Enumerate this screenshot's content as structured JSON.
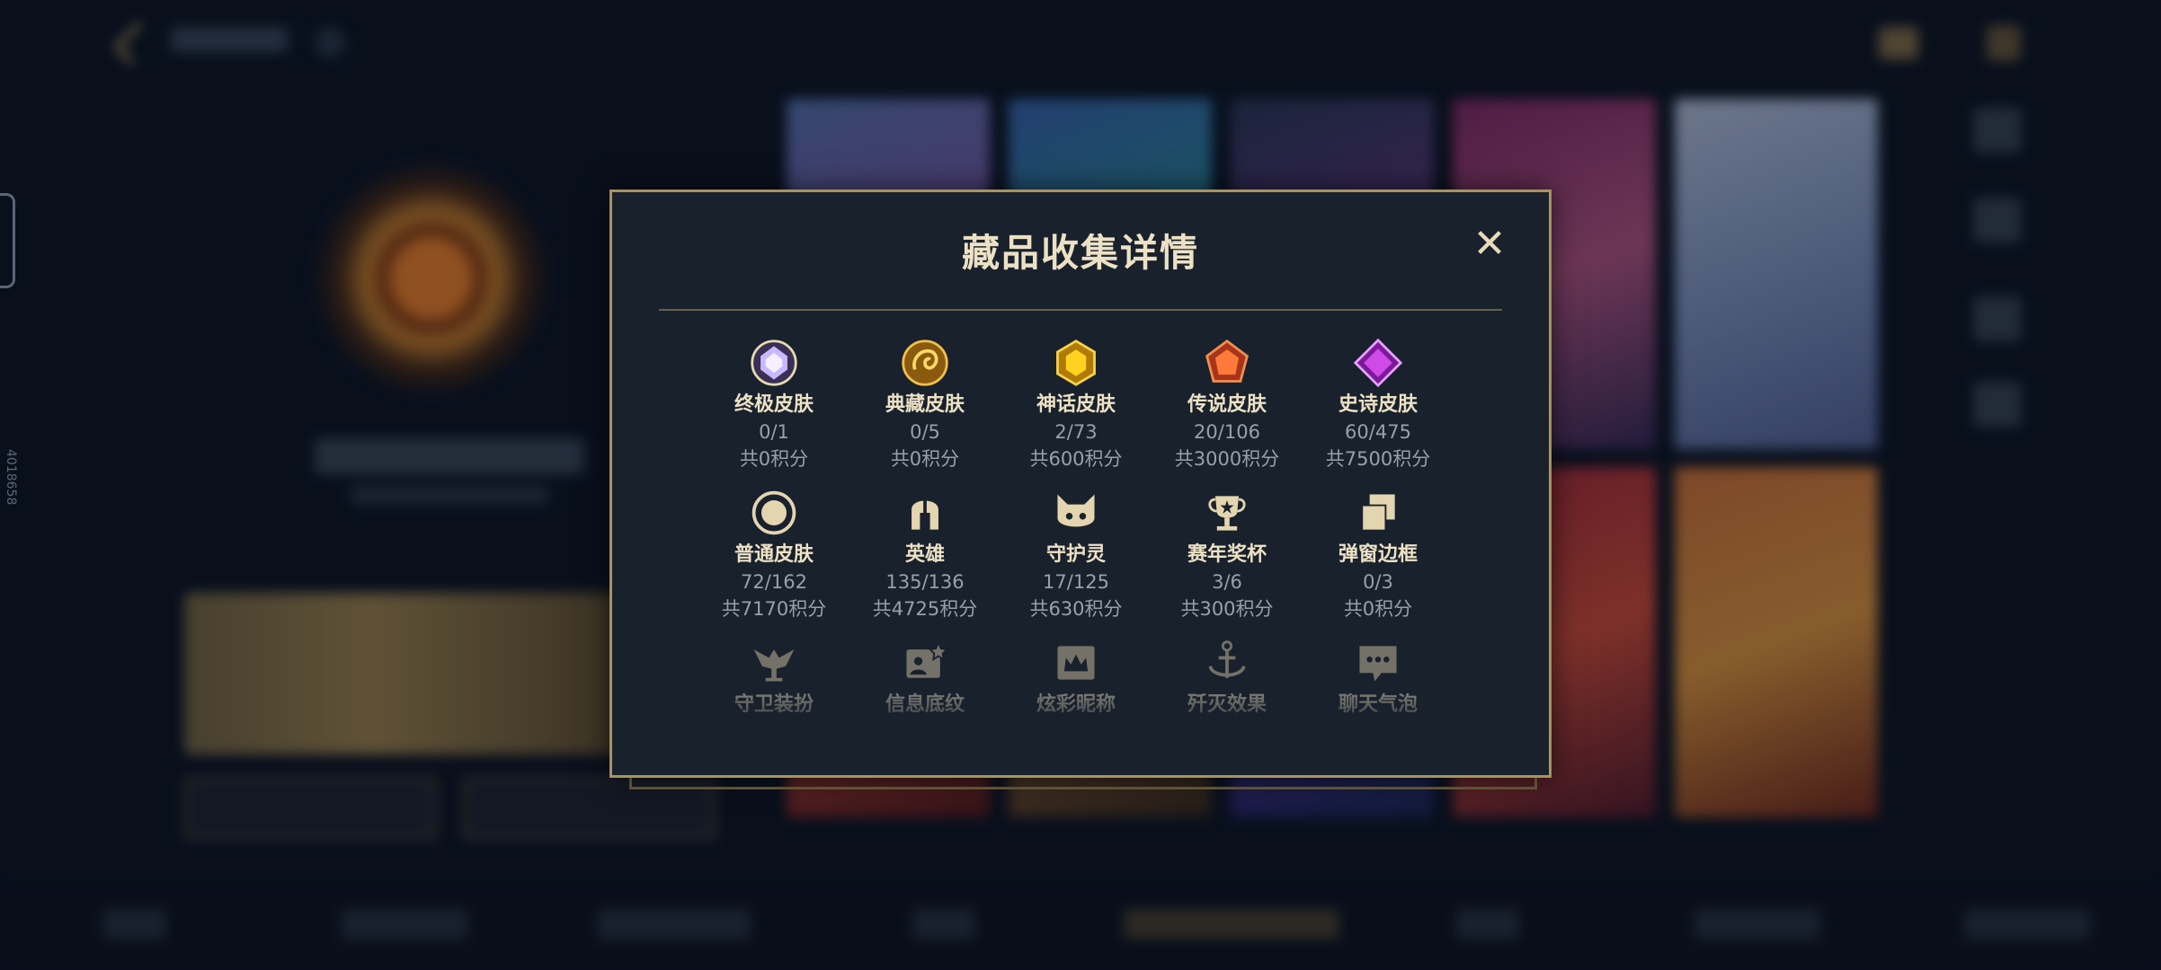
{
  "dialog": {
    "title": "藏品收集详情",
    "close_label": "✕"
  },
  "side_id": "4018658",
  "categories": [
    {
      "name": "终极皮肤",
      "count": "0/1",
      "points": "共0积分",
      "icon": "ultimate-skin-icon",
      "color": "#b9a6f0"
    },
    {
      "name": "典藏皮肤",
      "count": "0/5",
      "points": "共0积分",
      "icon": "collector-skin-icon",
      "color": "#e8b640"
    },
    {
      "name": "神话皮肤",
      "count": "2/73",
      "points": "共600积分",
      "icon": "mythic-skin-icon",
      "color": "#f0c21f"
    },
    {
      "name": "传说皮肤",
      "count": "20/106",
      "points": "共3000积分",
      "icon": "legendary-skin-icon",
      "color": "#f06a2a"
    },
    {
      "name": "史诗皮肤",
      "count": "60/475",
      "points": "共7500积分",
      "icon": "epic-skin-icon",
      "color": "#c63cd8"
    },
    {
      "name": "普通皮肤",
      "count": "72/162",
      "points": "共7170积分",
      "icon": "standard-skin-icon",
      "color": "#e3d5b0"
    },
    {
      "name": "英雄",
      "count": "135/136",
      "points": "共4725积分",
      "icon": "hero-helmet-icon",
      "color": "#e3d5b0"
    },
    {
      "name": "守护灵",
      "count": "17/125",
      "points": "共630积分",
      "icon": "guardian-spirit-icon",
      "color": "#e3d5b0"
    },
    {
      "name": "赛年奖杯",
      "count": "3/6",
      "points": "共300积分",
      "icon": "season-trophy-icon",
      "color": "#e3d5b0"
    },
    {
      "name": "弹窗边框",
      "count": "0/3",
      "points": "共0积分",
      "icon": "popup-frame-icon",
      "color": "#e3d5b0"
    },
    {
      "name": "守卫装扮",
      "icon": "ward-skin-icon",
      "color": "#e3d5b0"
    },
    {
      "name": "信息底纹",
      "icon": "profile-banner-icon",
      "color": "#e3d5b0"
    },
    {
      "name": "炫彩昵称",
      "icon": "colored-name-icon",
      "color": "#e3d5b0"
    },
    {
      "name": "歼灭效果",
      "icon": "elimination-effect-icon",
      "color": "#e3d5b0"
    },
    {
      "name": "聊天气泡",
      "icon": "chat-bubble-icon",
      "color": "#e3d5b0"
    }
  ]
}
